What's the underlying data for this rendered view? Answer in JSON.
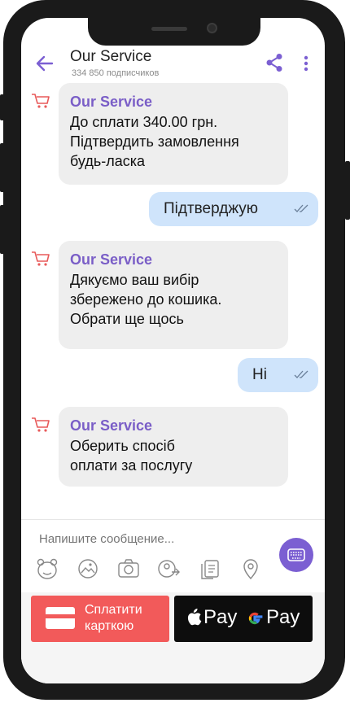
{
  "header": {
    "title": "Our Service",
    "subtitle": "334 850 подписчиков"
  },
  "messages": [
    {
      "sender": "Our Service",
      "text": "До сплати 340.00 грн.\nПідтвердить замовлення\nбудь-ласка"
    },
    {
      "reply": "Підтверджую"
    },
    {
      "sender": "Our Service",
      "text": "Дякуємо ваш вибір\nзбережено до кошика.\nОбрати ще щось"
    },
    {
      "reply": "Ні"
    },
    {
      "sender": "Our Service",
      "text": "Оберить спосіб\nоплати за послугу"
    }
  ],
  "composer": {
    "placeholder": "Напишите сообщение..."
  },
  "payments": {
    "card_label": "Сплатити\nкарткою",
    "apple_pay": "Pay",
    "google_pay": "Pay"
  },
  "colors": {
    "accent": "#7b5fd2",
    "card": "#f25a5a",
    "outgoing": "#cfe4fb",
    "incoming": "#eeeeee"
  }
}
